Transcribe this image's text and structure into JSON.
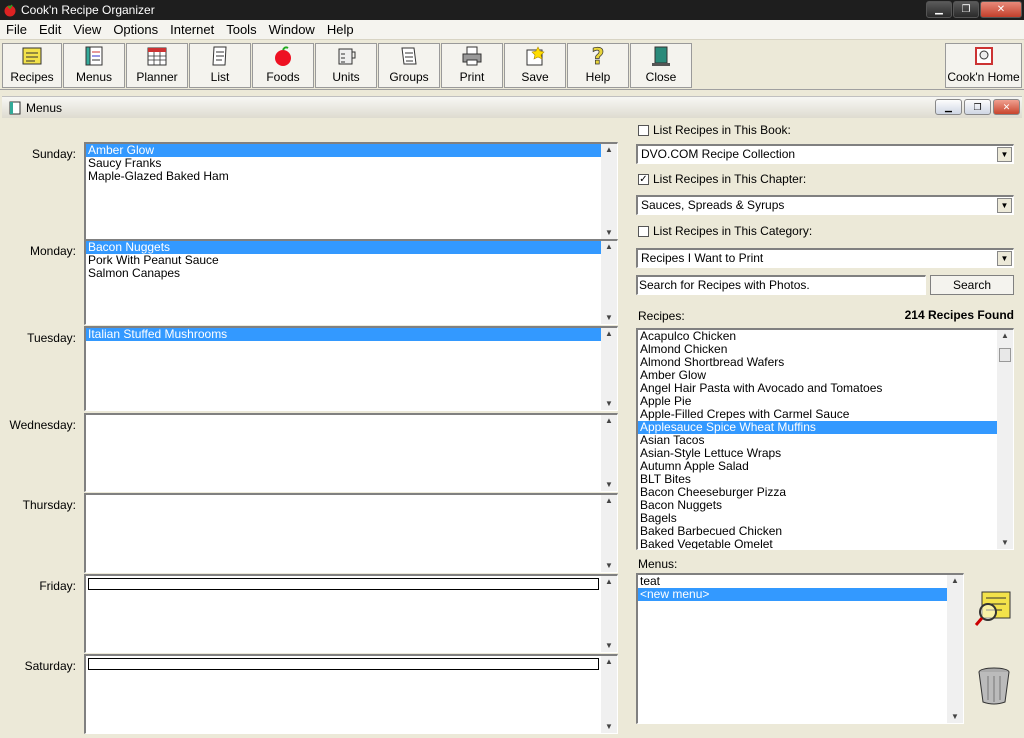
{
  "window": {
    "title": "Cook'n Recipe Organizer"
  },
  "menu": [
    "File",
    "Edit",
    "View",
    "Options",
    "Internet",
    "Tools",
    "Window",
    "Help"
  ],
  "toolbar": {
    "recipes": "Recipes",
    "menus": "Menus",
    "planner": "Planner",
    "list": "List",
    "foods": "Foods",
    "units": "Units",
    "groups": "Groups",
    "print": "Print",
    "save": "Save",
    "help": "Help",
    "close": "Close",
    "home": "Cook'n Home"
  },
  "child": {
    "title": "Menus"
  },
  "days": {
    "sunday": {
      "label": "Sunday:",
      "items": [
        "Amber Glow",
        "Saucy Franks",
        "Maple-Glazed Baked Ham"
      ]
    },
    "monday": {
      "label": "Monday:",
      "items": [
        "Bacon Nuggets",
        "Pork With Peanut Sauce",
        "Salmon Canapes"
      ]
    },
    "tuesday": {
      "label": "Tuesday:",
      "items": [
        "Italian Stuffed Mushrooms"
      ]
    },
    "wednesday": {
      "label": "Wednesday:"
    },
    "thursday": {
      "label": "Thursday:"
    },
    "friday": {
      "label": "Friday:"
    },
    "saturday": {
      "label": "Saturday:"
    }
  },
  "filters": {
    "book_label": "List Recipes in This Book:",
    "book_checked": false,
    "book_value": "DVO.COM Recipe Collection",
    "chapter_label": "List Recipes in This Chapter:",
    "chapter_checked": true,
    "chapter_value": "Sauces, Spreads & Syrups",
    "category_label": "List Recipes in This Category:",
    "category_checked": false,
    "category_value": "Recipes I Want to Print",
    "search_value": "Search for Recipes with Photos.",
    "search_button": "Search"
  },
  "recipes": {
    "label": "Recipes:",
    "count": "214 Recipes Found",
    "items": [
      "Acapulco Chicken",
      "Almond Chicken",
      "Almond Shortbread Wafers",
      "Amber Glow",
      "Angel Hair Pasta with Avocado and Tomatoes",
      "Apple Pie",
      "Apple-Filled Crepes with Carmel Sauce",
      "Applesauce Spice Wheat Muffins",
      "Asian Tacos",
      "Asian-Style Lettuce Wraps",
      "Autumn Apple Salad",
      "BLT Bites",
      "Bacon Cheeseburger Pizza",
      "Bacon Nuggets",
      "Bagels",
      "Baked Barbecued Chicken",
      "Baked Vegetable Omelet"
    ],
    "selected_index": 7
  },
  "menus": {
    "label": "Menus:",
    "items": [
      "teat",
      "<new menu>"
    ],
    "selected_index": 1
  },
  "colors": {
    "selection": "#3399ff",
    "title_bar": "#1e1e1e"
  }
}
